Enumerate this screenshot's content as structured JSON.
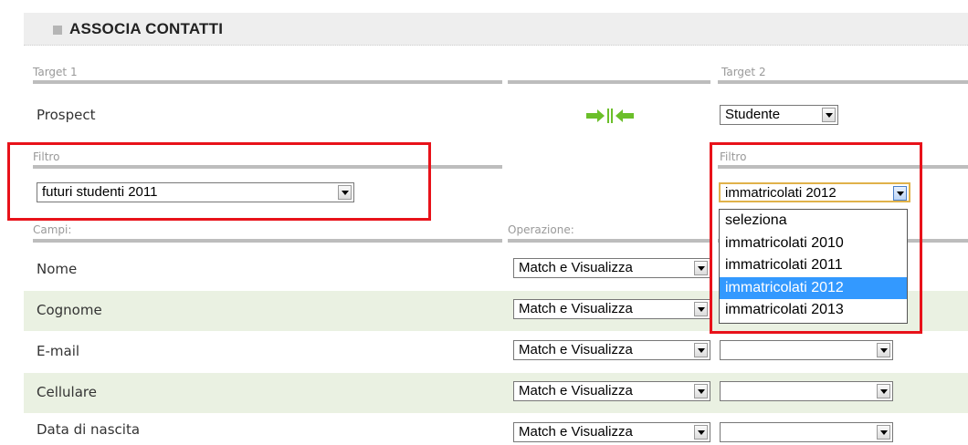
{
  "header": {
    "title": "ASSOCIA CONTATTI"
  },
  "target1": {
    "label": "Target 1",
    "value": "Prospect"
  },
  "target2": {
    "label": "Target 2",
    "selected": "Studente"
  },
  "filtro1": {
    "label": "Filtro",
    "selected": "futuri studenti 2011"
  },
  "filtro2": {
    "label": "Filtro",
    "selected": "immatricolati 2012",
    "options": [
      "seleziona",
      "immatricolati 2010",
      "immatricolati 2011",
      "immatricolati 2012",
      "immatricolati 2013"
    ],
    "highlighted_index": 3
  },
  "table": {
    "col_campi": "Campi:",
    "col_operazione": "Operazione:",
    "rows": [
      {
        "campo": "Nome",
        "operazione": "Match e Visualizza",
        "campo2": ""
      },
      {
        "campo": "Cognome",
        "operazione": "Match e Visualizza",
        "campo2": ""
      },
      {
        "campo": "E-mail",
        "operazione": "Match e Visualizza",
        "campo2": ""
      },
      {
        "campo": "Cellulare",
        "operazione": "Match e Visualizza",
        "campo2": ""
      },
      {
        "campo": "Data di nascita",
        "operazione": "Match e Visualizza",
        "campo2": ""
      }
    ]
  },
  "colors": {
    "highlight_box": "#e8121a",
    "row_alt": "#eaf1e2",
    "selection": "#3399ff",
    "arrow": "#6bbf2a"
  },
  "icons": {
    "link": "merge-arrows-icon",
    "dropdown": "chevron-down-icon"
  }
}
